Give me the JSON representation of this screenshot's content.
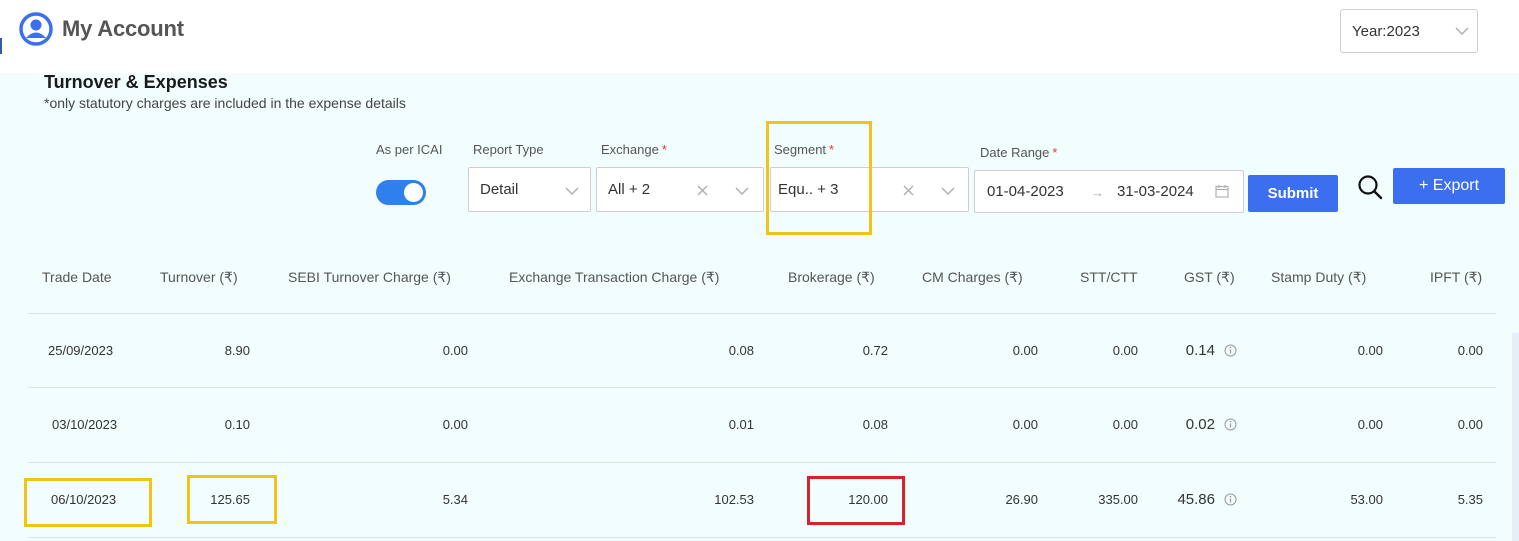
{
  "header": {
    "title": "My Account",
    "year_select": "Year:2023"
  },
  "section": {
    "title": "Turnover & Expenses",
    "note": "*only statutory charges are included in the expense details"
  },
  "filters": {
    "icai_label": "As per ICAI",
    "icai_enabled": true,
    "report_type_label": "Report Type",
    "report_type_value": "Detail",
    "exchange_label": "Exchange",
    "exchange_value": "All + 2",
    "segment_label": "Segment",
    "segment_value": "Equ.. + 3",
    "date_range_label": "Date Range",
    "date_from": "01-04-2023",
    "date_to": "31-03-2024",
    "required_mark": "*"
  },
  "actions": {
    "submit_label": "Submit",
    "export_label": "+ Export"
  },
  "table": {
    "columns": [
      "Trade Date",
      "Turnover (₹)",
      "SEBI Turnover Charge (₹)",
      "Exchange Transaction Charge (₹)",
      "Brokerage (₹)",
      "CM Charges (₹)",
      "STT/CTT",
      "GST (₹)",
      "Stamp Duty (₹)",
      "IPFT (₹)"
    ],
    "rows": [
      [
        "25/09/2023",
        "8.90",
        "0.00",
        "0.08",
        "0.72",
        "0.00",
        "0.00",
        "0.14",
        "0.00",
        "0.00"
      ],
      [
        "03/10/2023",
        "0.10",
        "0.00",
        "0.01",
        "0.08",
        "0.00",
        "0.00",
        "0.02",
        "0.00",
        "0.00"
      ],
      [
        "06/10/2023",
        "125.65",
        "5.34",
        "102.53",
        "120.00",
        "26.90",
        "335.00",
        "45.86",
        "53.00",
        "5.35"
      ]
    ]
  },
  "colors": {
    "primary": "#3b6ff0",
    "toggle": "#2f80ed",
    "panel_bg": "#f2fdfd",
    "highlight_yellow": "#f2c417",
    "highlight_red": "#d6232a"
  },
  "icons": {
    "logo": "user-circle-icon",
    "chevron": "chevron-down-icon",
    "clear": "close-icon",
    "calendar": "calendar-icon",
    "search": "search-icon",
    "info": "info-icon"
  }
}
